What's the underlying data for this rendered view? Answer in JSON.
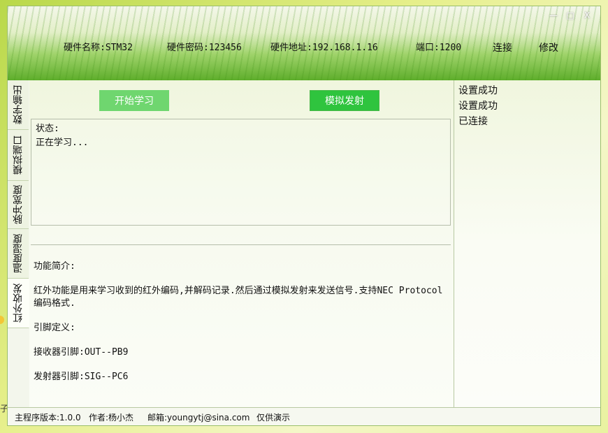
{
  "outside": {
    "fragment": "子"
  },
  "window": {
    "buttons": {
      "minimize": "—",
      "maximize": "□",
      "close": "X"
    }
  },
  "info": {
    "hw_name": "硬件名称:STM32",
    "hw_password": "硬件密码:123456",
    "hw_address": "硬件地址:192.168.1.16",
    "port": "端口:1200",
    "connect": "连接",
    "modify": "修改"
  },
  "tabs": [
    {
      "label": "数字输出"
    },
    {
      "label": "模拟端口"
    },
    {
      "label": "脉冲宽度"
    },
    {
      "label": "温度湿度"
    },
    {
      "label": "红外收发",
      "active": true
    }
  ],
  "main": {
    "start_learn": "开始学习",
    "simulate_send": "模拟发射",
    "status_label": "状态:",
    "status_text": "正在学习...",
    "desc": {
      "intro_title": "功能简介:",
      "intro_text": "红外功能是用来学习收到的红外编码,并解码记录.然后通过模拟发射来发送信号.支持NEC Protocol编码格式.",
      "pin_title": "引脚定义:",
      "receiver": "接收器引脚:OUT--PB9",
      "transmitter": "发射器引脚:SIG--PC6"
    }
  },
  "log": [
    "设置成功",
    "设置成功",
    "已连接"
  ],
  "statusbar": {
    "version": "主程序版本:1.0.0",
    "author": "作者:杨小杰",
    "email": "邮箱:youngytj@sina.com",
    "note": "仅供演示"
  },
  "colors": {
    "accent_green": "#2fc43e",
    "learn_green": "#6fd66f"
  }
}
